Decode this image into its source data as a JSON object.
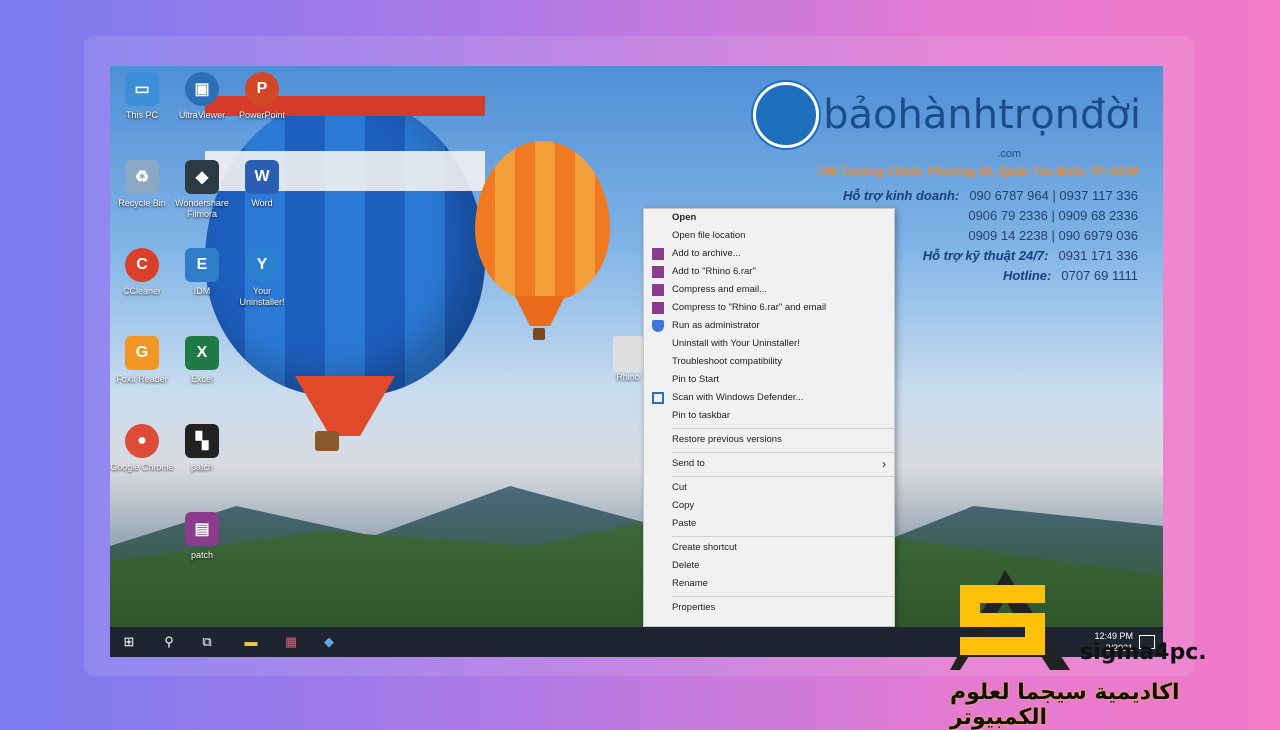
{
  "desktop_icons": [
    {
      "label": "This PC",
      "color": "#3a8fd8"
    },
    {
      "label": "UltraViewer",
      "color": "#2d6fb5"
    },
    {
      "label": "PowerPoint",
      "color": "#d24726"
    },
    {
      "label": "Recycle Bin",
      "color": "#8aa7c4"
    },
    {
      "label": "Wondershare Filmora",
      "color": "#2d3a44"
    },
    {
      "label": "Word",
      "color": "#2b5fb3"
    },
    {
      "label": "CCleaner",
      "color": "#d8402a"
    },
    {
      "label": "IDM",
      "color": "#2f7cc9"
    },
    {
      "label": "Your Uninstaller!",
      "color": "#2a7fcf"
    },
    {
      "label": "Foxit Reader",
      "color": "#f29624"
    },
    {
      "label": "Excel",
      "color": "#1f7a45"
    },
    {
      "label": "Google Chrome",
      "color": "#dd4b39"
    },
    {
      "label": "patch",
      "color": "#222222"
    },
    {
      "label": "patch",
      "color": "#8a3b8c"
    }
  ],
  "rhino_label": "Rhino",
  "brand": {
    "name": "bảohànhtrọnđời",
    "com": ".com",
    "address": "746 Trường Chinh, Phường 15, Quận Tân Bình, TP. HCM",
    "rows": [
      {
        "k": "Hỗ trợ kinh doanh:",
        "v": "090 6787 964 | 0937 117 336"
      },
      {
        "k": "",
        "v": "0906 79 2336 | 0909 68 2336"
      },
      {
        "k": "",
        "v": "0909 14 2238 | 090 6979 036"
      },
      {
        "k": "Hỗ trợ kỹ thuật 24/7:",
        "v": "0931 171 336"
      },
      {
        "k": "Hotline:",
        "v": "0707 69 1111"
      }
    ]
  },
  "context_menu": {
    "group1": [
      "Open",
      "Open file location",
      "Add to archive...",
      "Add to \"Rhino 6.rar\"",
      "Compress and email...",
      "Compress to \"Rhino 6.rar\" and email",
      "Run as administrator",
      "Uninstall with Your Uninstaller!",
      "Troubleshoot compatibility",
      "Pin to Start",
      "Scan with Windows Defender...",
      "Pin to taskbar"
    ],
    "group2": [
      "Restore previous versions"
    ],
    "group3": [
      "Send to"
    ],
    "group4": [
      "Cut",
      "Copy",
      "Paste"
    ],
    "group5": [
      "Create shortcut",
      "Delete",
      "Rename"
    ],
    "group6": [
      "Properties"
    ]
  },
  "taskbar": {
    "time": "12:49 PM",
    "date": "2/2021"
  },
  "watermark": {
    "sigma": "sigma4pc.",
    "arabic": "اكاديمية سيجما لعلوم الكمبيوتر"
  }
}
